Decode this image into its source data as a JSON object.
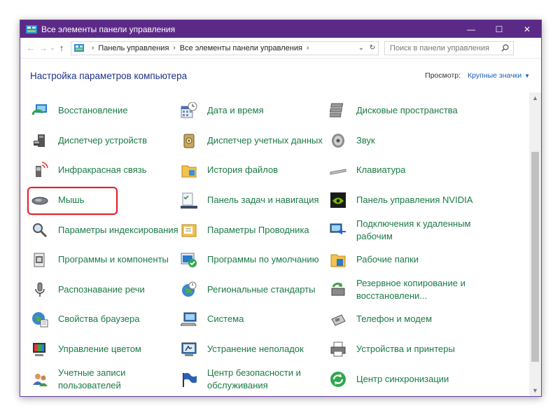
{
  "window": {
    "title": "Все элементы панели управления",
    "minimize": "—",
    "maximize": "☐",
    "close": "✕"
  },
  "address": {
    "back": "←",
    "forward": "→",
    "up": "↑",
    "crumbs": [
      "Панель управления",
      "Все элементы панели управления"
    ],
    "separator": "›",
    "dropdown": "⌄",
    "refresh": "↻",
    "search_placeholder": "Поиск в панели управления",
    "search_icon": "search-icon"
  },
  "header": {
    "title": "Настройка параметров компьютера",
    "view_label": "Просмотр:",
    "view_value": "Крупные значки",
    "view_caret": "▼"
  },
  "items": [
    {
      "label": "Восстановление",
      "icon": "recovery-icon"
    },
    {
      "label": "Дата и время",
      "icon": "calendar-clock-icon"
    },
    {
      "label": "Дисковые пространства",
      "icon": "storage-spaces-icon"
    },
    {
      "label": "Диспетчер устройств",
      "icon": "device-manager-icon"
    },
    {
      "label": "Диспетчер учетных данных",
      "icon": "credential-vault-icon"
    },
    {
      "label": "Звук",
      "icon": "speaker-icon"
    },
    {
      "label": "Инфракрасная связь",
      "icon": "infrared-icon"
    },
    {
      "label": "История файлов",
      "icon": "file-history-icon"
    },
    {
      "label": "Клавиатура",
      "icon": "keyboard-icon"
    },
    {
      "label": "Мышь",
      "icon": "mouse-icon",
      "highlighted": true
    },
    {
      "label": "Панель задач и навигация",
      "icon": "taskbar-icon"
    },
    {
      "label": "Панель управления NVIDIA",
      "icon": "nvidia-icon"
    },
    {
      "label": "Параметры индексирования",
      "icon": "indexing-icon"
    },
    {
      "label": "Параметры Проводника",
      "icon": "explorer-options-icon"
    },
    {
      "label": "Подключения к удаленным рабочим",
      "icon": "remote-desktop-icon"
    },
    {
      "label": "Программы и компоненты",
      "icon": "programs-icon"
    },
    {
      "label": "Программы по умолчанию",
      "icon": "default-programs-icon"
    },
    {
      "label": "Рабочие папки",
      "icon": "work-folders-icon"
    },
    {
      "label": "Распознавание речи",
      "icon": "microphone-icon"
    },
    {
      "label": "Региональные стандарты",
      "icon": "globe-clock-icon"
    },
    {
      "label": "Резервное копирование и восстановлени...",
      "icon": "backup-icon"
    },
    {
      "label": "Свойства браузера",
      "icon": "internet-options-icon"
    },
    {
      "label": "Система",
      "icon": "system-icon"
    },
    {
      "label": "Телефон и модем",
      "icon": "phone-modem-icon"
    },
    {
      "label": "Управление цветом",
      "icon": "color-management-icon"
    },
    {
      "label": "Устранение неполадок",
      "icon": "troubleshooting-icon"
    },
    {
      "label": "Устройства и принтеры",
      "icon": "printer-icon"
    },
    {
      "label": "Учетные записи пользователей",
      "icon": "user-accounts-icon"
    },
    {
      "label": "Центр безопасности и обслуживания",
      "icon": "flag-icon"
    },
    {
      "label": "Центр синхронизации",
      "icon": "sync-icon"
    }
  ],
  "colors": {
    "titlebar": "#5b2a86",
    "link": "#1b7a44",
    "heading": "#1e3287",
    "highlight": "#e0222c"
  }
}
